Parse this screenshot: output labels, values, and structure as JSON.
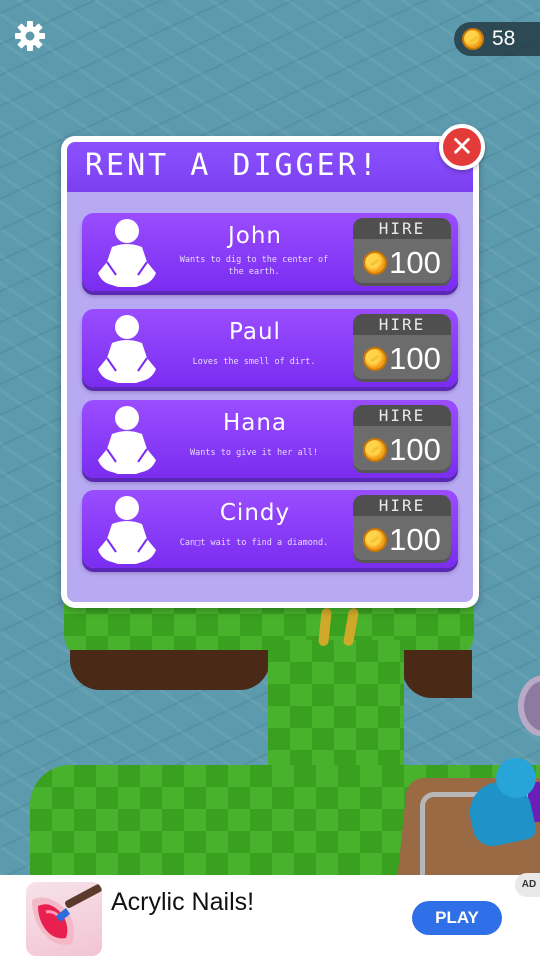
{
  "hud": {
    "coins": "58",
    "settings_icon": "gear-icon",
    "coin_icon": "coin-icon"
  },
  "modal": {
    "title": "RENT A DIGGER!",
    "close_icon": "close-icon",
    "diggers": [
      {
        "name": "John",
        "description": "Wants to dig to the center of the earth.",
        "hire_label": "HIRE",
        "price": "100"
      },
      {
        "name": "Paul",
        "description": "Loves the smell of dirt.",
        "hire_label": "HIRE",
        "price": "100"
      },
      {
        "name": "Hana",
        "description": "Wants to give it her all!",
        "hire_label": "HIRE",
        "price": "100"
      },
      {
        "name": "Cindy",
        "description": "Can□t wait to find a diamond.",
        "hire_label": "HIRE",
        "price": "100"
      }
    ]
  },
  "ad": {
    "title": "Acrylic Nails!",
    "cta": "PLAY",
    "badge": "AD"
  },
  "colors": {
    "header_purple": "#7b3ff0",
    "body_lavender": "#b8a9f3",
    "close_red": "#e33a3a",
    "play_blue": "#2f6fe8"
  }
}
